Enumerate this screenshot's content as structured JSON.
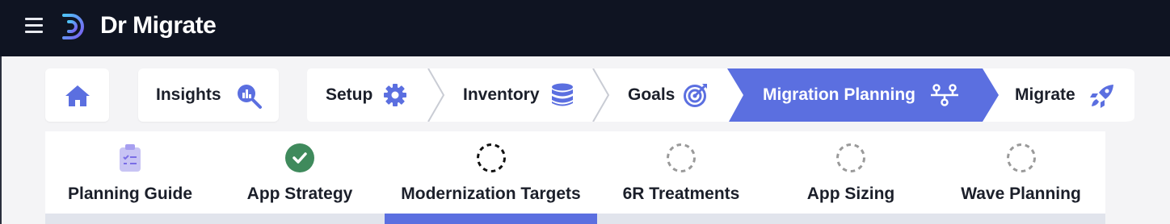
{
  "app": {
    "title": "Dr Migrate"
  },
  "nav": {
    "home_icon": "home-icon",
    "items": [
      {
        "label": "Insights",
        "icon": "magnifier-chart-icon"
      },
      {
        "label": "Setup",
        "icon": "gear-icon"
      },
      {
        "label": "Inventory",
        "icon": "database-icon"
      },
      {
        "label": "Goals",
        "icon": "target-icon"
      },
      {
        "label": "Migration Planning",
        "icon": "network-icon",
        "active": true
      },
      {
        "label": "Migrate",
        "icon": "rocket-icon"
      }
    ],
    "active_color": "#5b6fe0"
  },
  "steps": [
    {
      "label": "Planning Guide",
      "state": "clipboard"
    },
    {
      "label": "App Strategy",
      "state": "complete"
    },
    {
      "label": "Modernization Targets",
      "state": "current"
    },
    {
      "label": "6R Treatments",
      "state": "pending"
    },
    {
      "label": "App Sizing",
      "state": "pending"
    },
    {
      "label": "Wave Planning",
      "state": "pending"
    }
  ],
  "colors": {
    "accent": "#5b6fe0",
    "complete": "#3f8a5c",
    "topbar": "#0f1422"
  }
}
